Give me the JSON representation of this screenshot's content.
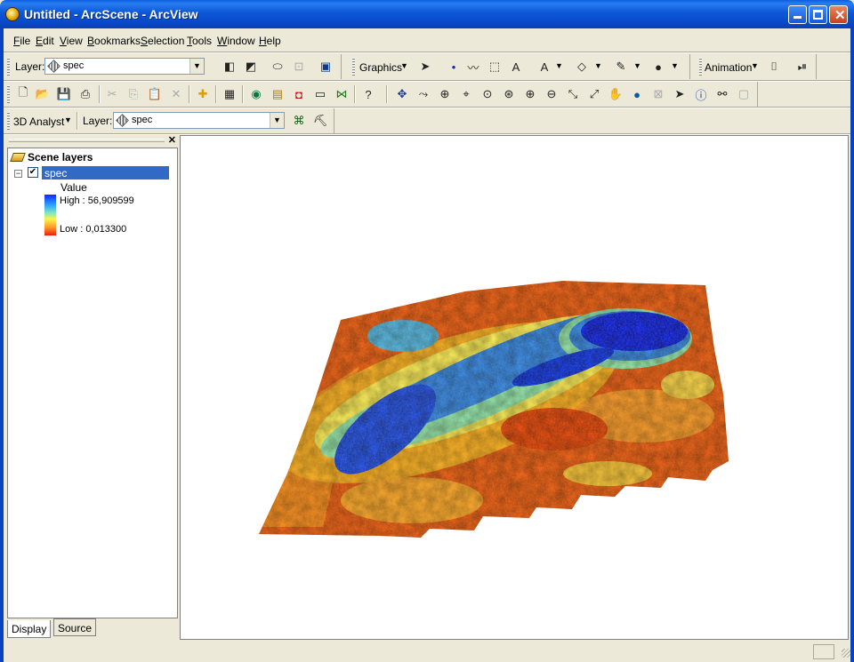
{
  "window": {
    "title": "Untitled - ArcScene - ArcView"
  },
  "menu": [
    "File",
    "Edit",
    "View",
    "Bookmarks",
    "Selection",
    "Tools",
    "Window",
    "Help"
  ],
  "toolbar1": {
    "layer_label": "Layer:",
    "layer_value": "spec",
    "graphics_label": "Graphics",
    "animation_label": "Animation"
  },
  "toolbar3": {
    "analyst_label": "3D Analyst",
    "layer_label": "Layer:",
    "layer_value": "spec"
  },
  "toc": {
    "root_label": "Scene layers",
    "layer_name": "spec",
    "legend_title": "Value",
    "high_label": "High : 56,909599",
    "low_label": "Low : 0,013300",
    "tabs": [
      "Display",
      "Source"
    ]
  },
  "colors": {
    "ramp": [
      "#0a2cff",
      "#2aa0ff",
      "#7fe8c0",
      "#fff34a",
      "#ff9a2a",
      "#e81e0a"
    ]
  }
}
